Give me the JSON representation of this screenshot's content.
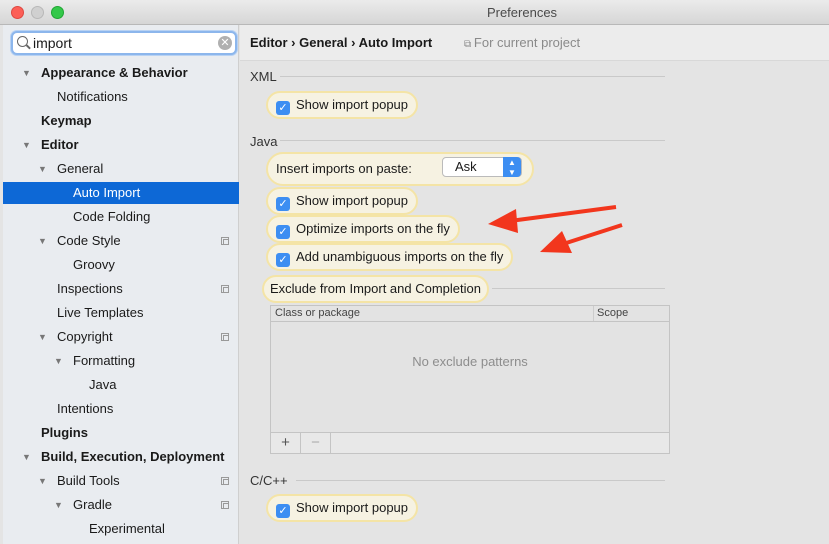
{
  "window": {
    "title": "Preferences"
  },
  "search": {
    "value": "import",
    "icon": "search-icon"
  },
  "tree": [
    {
      "label": "Appearance & Behavior",
      "level": 0,
      "bold": true,
      "expanded": true
    },
    {
      "label": "Notifications",
      "level": 1
    },
    {
      "label": "Keymap",
      "level": 0,
      "bold": true
    },
    {
      "label": "Editor",
      "level": 0,
      "bold": true,
      "expanded": true
    },
    {
      "label": "General",
      "level": 1,
      "expanded": true
    },
    {
      "label": "Auto Import",
      "level": 2,
      "selected": true
    },
    {
      "label": "Code Folding",
      "level": 2
    },
    {
      "label": "Code Style",
      "level": 1,
      "expanded": true,
      "project": true
    },
    {
      "label": "Groovy",
      "level": 2
    },
    {
      "label": "Inspections",
      "level": 1,
      "project": true
    },
    {
      "label": "Live Templates",
      "level": 1
    },
    {
      "label": "Copyright",
      "level": 1,
      "expanded": true,
      "project": true
    },
    {
      "label": "Formatting",
      "level": 2,
      "expanded": true
    },
    {
      "label": "Java",
      "level": 3
    },
    {
      "label": "Intentions",
      "level": 1
    },
    {
      "label": "Plugins",
      "level": 0,
      "bold": true
    },
    {
      "label": "Build, Execution, Deployment",
      "level": 0,
      "bold": true,
      "expanded": true
    },
    {
      "label": "Build Tools",
      "level": 1,
      "expanded": true,
      "project": true
    },
    {
      "label": "Gradle",
      "level": 2,
      "expanded": true,
      "project": true
    },
    {
      "label": "Experimental",
      "level": 3
    }
  ],
  "header": {
    "breadcrumb": "Editor › General › Auto Import",
    "scope": "For current project"
  },
  "xml": {
    "title": "XML",
    "show_popup": {
      "label": "Show import popup",
      "checked": true
    }
  },
  "java": {
    "title": "Java",
    "insert_label": "Insert imports on paste:",
    "insert_value": "Ask",
    "show_popup": {
      "label": "Show import popup",
      "checked": true
    },
    "optimize": {
      "label": "Optimize imports on the fly",
      "checked": true
    },
    "unambiguous": {
      "label": "Add unambiguous imports on the fly",
      "checked": true
    }
  },
  "exclude": {
    "title": "Exclude from Import and Completion",
    "columns": [
      "Class or package",
      "Scope"
    ],
    "empty": "No exclude patterns",
    "add": "+",
    "remove": "−"
  },
  "cpp": {
    "title": "C/C++",
    "show_popup": {
      "label": "Show import popup",
      "checked": true
    }
  },
  "colors": {
    "selection": "#0d68d6",
    "checkbox": "#3d8ef2",
    "highlight": "#f4e4a6",
    "arrow": "#f2361d"
  }
}
